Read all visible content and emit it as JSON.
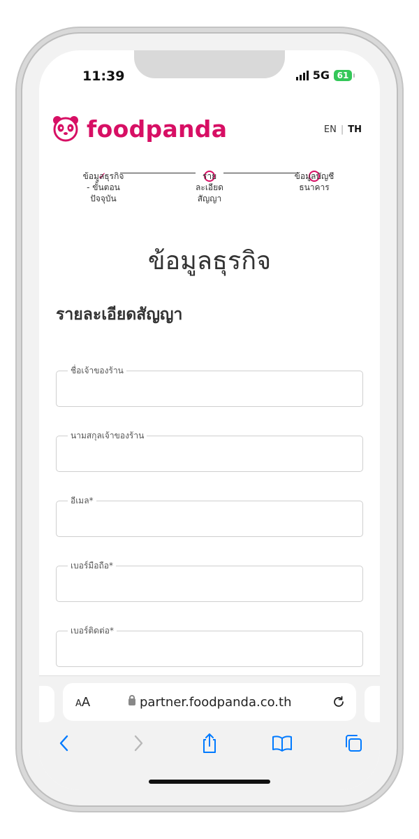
{
  "status": {
    "time": "11:39",
    "network": "5G",
    "battery": "61"
  },
  "header": {
    "brand": "foodpanda",
    "lang_en": "EN",
    "lang_sep": "|",
    "lang_th": "TH"
  },
  "stepper": {
    "steps": [
      {
        "label": "ข้อมูลธุรกิจ - ขั้นตอนปัจจุบัน",
        "state": "current"
      },
      {
        "label": "รายละเอียดสัญญา",
        "state": "upcoming"
      },
      {
        "label": "ข้อมูลบัญชีธนาคาร",
        "state": "upcoming"
      }
    ]
  },
  "page": {
    "title": "ข้อมูลธุรกิจ",
    "section_title": "รายละเอียดสัญญา"
  },
  "form": {
    "fields": [
      {
        "label": "ชื่อเจ้าของร้าน",
        "value": ""
      },
      {
        "label": "นามสกุลเจ้าของร้าน",
        "value": ""
      },
      {
        "label": "อีเมล*",
        "value": ""
      },
      {
        "label": "เบอร์มือถือ*",
        "value": ""
      },
      {
        "label": "เบอร์ติดต่อ*",
        "value": ""
      }
    ]
  },
  "browser": {
    "aa_small": "A",
    "aa_large": "A",
    "url": "partner.foodpanda.co.th"
  },
  "colors": {
    "brand": "#d70f64",
    "battery": "#34c759",
    "ios_blue": "#007aff"
  }
}
